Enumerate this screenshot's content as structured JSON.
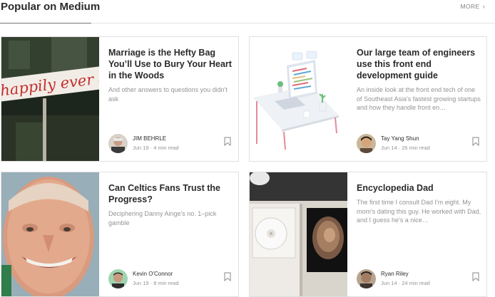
{
  "section": {
    "title": "Popular on Medium",
    "more_label": "MORE",
    "more_icon": "chevron-right-icon"
  },
  "cards": [
    {
      "title": "Marriage is the Hefty Bag You’ll Use to Bury Your Heart in the Woods",
      "subtitle": "And other answers to questions you didn't ask",
      "author": "JIM BEHRLE",
      "date": "Jun 19",
      "read_time": "4 min read",
      "thumb_text": "happily ever afte"
    },
    {
      "title": "Our large team of engineers use this front end development guide",
      "subtitle": "An inside look at the front end tech of one of Southeast Asia's fastest growing startups and how they handle front en…",
      "author": "Tay Yang Shun",
      "date": "Jun 14",
      "read_time": "26 min read"
    },
    {
      "title": "Can Celtics Fans Trust the Progress?",
      "subtitle": "Deciphering Danny Ainge's no. 1–pick gamble",
      "author": "Kevin O'Connor",
      "date": "Jun 19",
      "read_time": "8 min read"
    },
    {
      "title": "Encyclopedia Dad",
      "subtitle": "The first time I consult Dad I'm eight. My mom's dating this guy. He worked with Dad, and I guess he's a nice…",
      "author": "Ryan Riley",
      "date": "Jun 14",
      "read_time": "24 min read"
    }
  ],
  "meta_separator": "·",
  "colors": {
    "accent": "#03a87c",
    "text": "#292929",
    "muted": "#8a8a8a"
  }
}
